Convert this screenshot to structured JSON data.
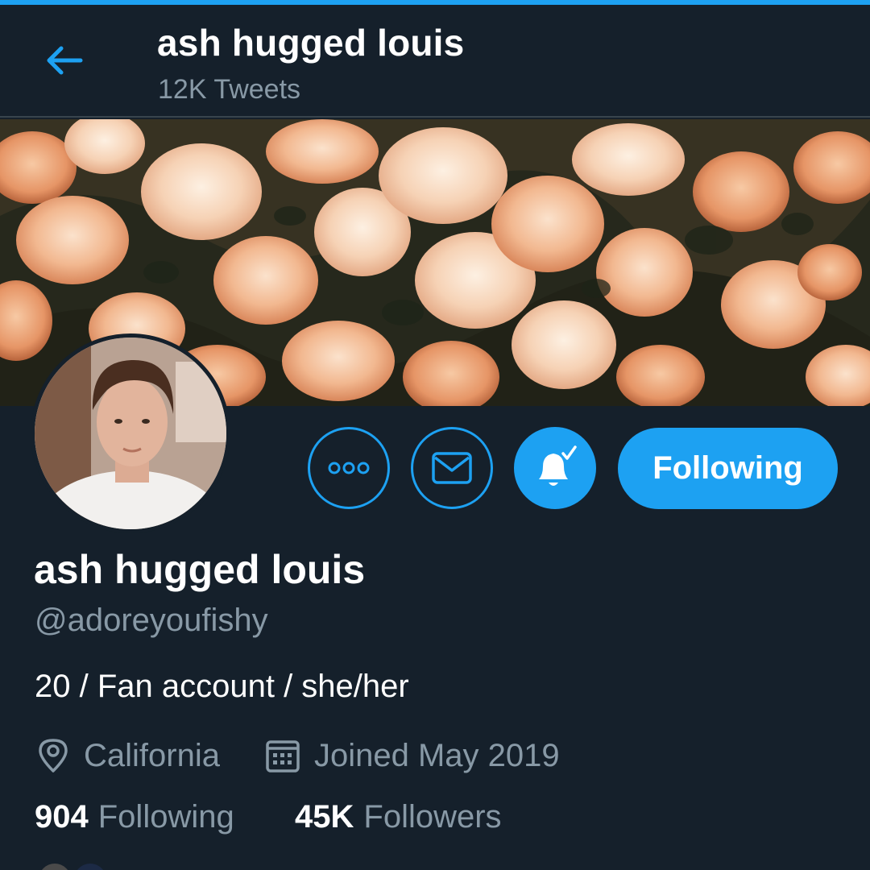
{
  "app": {
    "accent_color": "#1da1f2",
    "background_color": "#15202b",
    "secondary_text_color": "#8899a6"
  },
  "header": {
    "back_icon": "arrow-left-icon",
    "title": "ash hugged louis",
    "tweet_count": "12K Tweets"
  },
  "banner": {
    "image": "peach flowers photo"
  },
  "profile": {
    "avatar": "profile photo",
    "display_name": "ash hugged louis",
    "handle": "@adoreyoufishy",
    "bio": "20 / Fan account / she/her",
    "location": "California",
    "location_icon": "location-pin-icon",
    "joined": "Joined May 2019",
    "joined_icon": "calendar-icon"
  },
  "actions": {
    "more_icon": "more-options-icon",
    "message_icon": "envelope-icon",
    "notify_icon": "bell-check-icon",
    "following_label": "Following"
  },
  "stats": {
    "following_count": "904",
    "following_label": "Following",
    "followers_count": "45K",
    "followers_label": "Followers"
  }
}
